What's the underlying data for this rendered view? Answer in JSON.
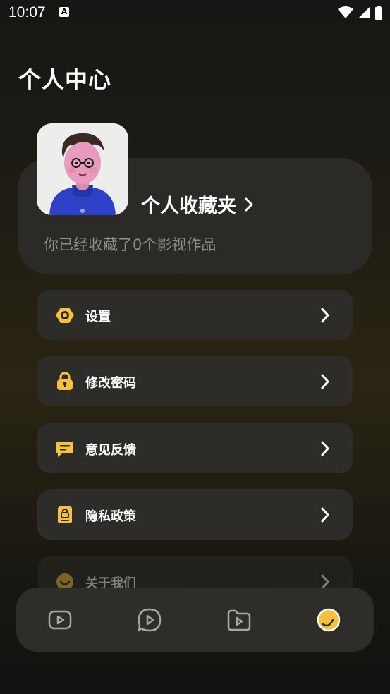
{
  "status_bar": {
    "time": "10:07",
    "notification_badge": "A"
  },
  "page": {
    "title": "个人中心"
  },
  "collection": {
    "title": "个人收藏夹",
    "subtitle": "你已经收藏了0个影视作品"
  },
  "menu": [
    {
      "label": "设置",
      "icon": "settings-hexagon-icon"
    },
    {
      "label": "修改密码",
      "icon": "lock-icon"
    },
    {
      "label": "意见反馈",
      "icon": "feedback-chat-icon"
    },
    {
      "label": "隐私政策",
      "icon": "privacy-document-icon"
    },
    {
      "label": "关于我们",
      "icon": "smile-icon"
    }
  ],
  "bottom_nav": [
    {
      "icon": "video-home-icon",
      "active": false
    },
    {
      "icon": "play-chat-icon",
      "active": false
    },
    {
      "icon": "video-folder-icon",
      "active": false
    },
    {
      "icon": "profile-moon-icon",
      "active": true
    }
  ],
  "colors": {
    "accent": "#f5c13e",
    "card": "#2d2c28",
    "muted_text": "#8f8d86"
  }
}
